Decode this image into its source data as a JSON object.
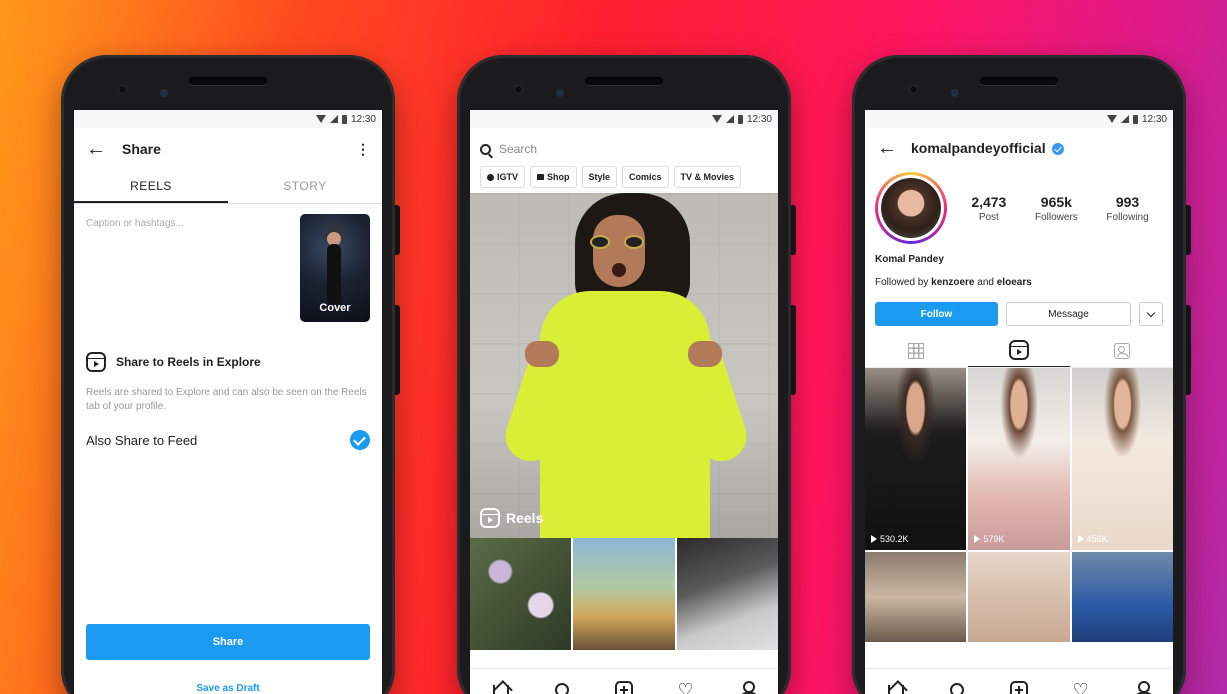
{
  "status_bar": {
    "time": "12:30"
  },
  "share_screen": {
    "title": "Share",
    "tabs": [
      "REELS",
      "STORY"
    ],
    "caption_placeholder": "Caption or hashtags...",
    "cover_label": "Cover",
    "explore_title": "Share to Reels in Explore",
    "explore_description": "Reels are shared to Explore and can also be seen on the Reels tab of your profile.",
    "feed_label": "Also Share to Feed",
    "feed_checked": true,
    "share_button": "Share",
    "draft_link": "Save as Draft"
  },
  "explore_screen": {
    "search_placeholder": "Search",
    "chips": [
      "IGTV",
      "Shop",
      "Style",
      "Comics",
      "TV & Movies"
    ],
    "reels_label": "Reels"
  },
  "profile_screen": {
    "username": "komalpandeyofficial",
    "stats": [
      {
        "value": "2,473",
        "label": "Post"
      },
      {
        "value": "965k",
        "label": "Followers"
      },
      {
        "value": "993",
        "label": "Following"
      }
    ],
    "display_name": "Komal Pandey",
    "followed_by_prefix": "Followed by",
    "followed_by_user1": "kenzoere",
    "followed_by_and": "and",
    "followed_by_user2": "eloears",
    "follow_button": "Follow",
    "message_button": "Message",
    "reel_views": [
      "530.2K",
      "579K",
      "456K"
    ]
  },
  "colors": {
    "accent_blue": "#1a9bf0",
    "background_gradient": [
      "#ff9a1a",
      "#ff1f2e",
      "#b02aa8"
    ]
  },
  "icons": {
    "back": "arrow-left-icon",
    "more": "kebab-menu-icon",
    "nav": [
      "home-icon",
      "search-icon",
      "add-icon",
      "heart-icon",
      "profile-icon"
    ]
  }
}
